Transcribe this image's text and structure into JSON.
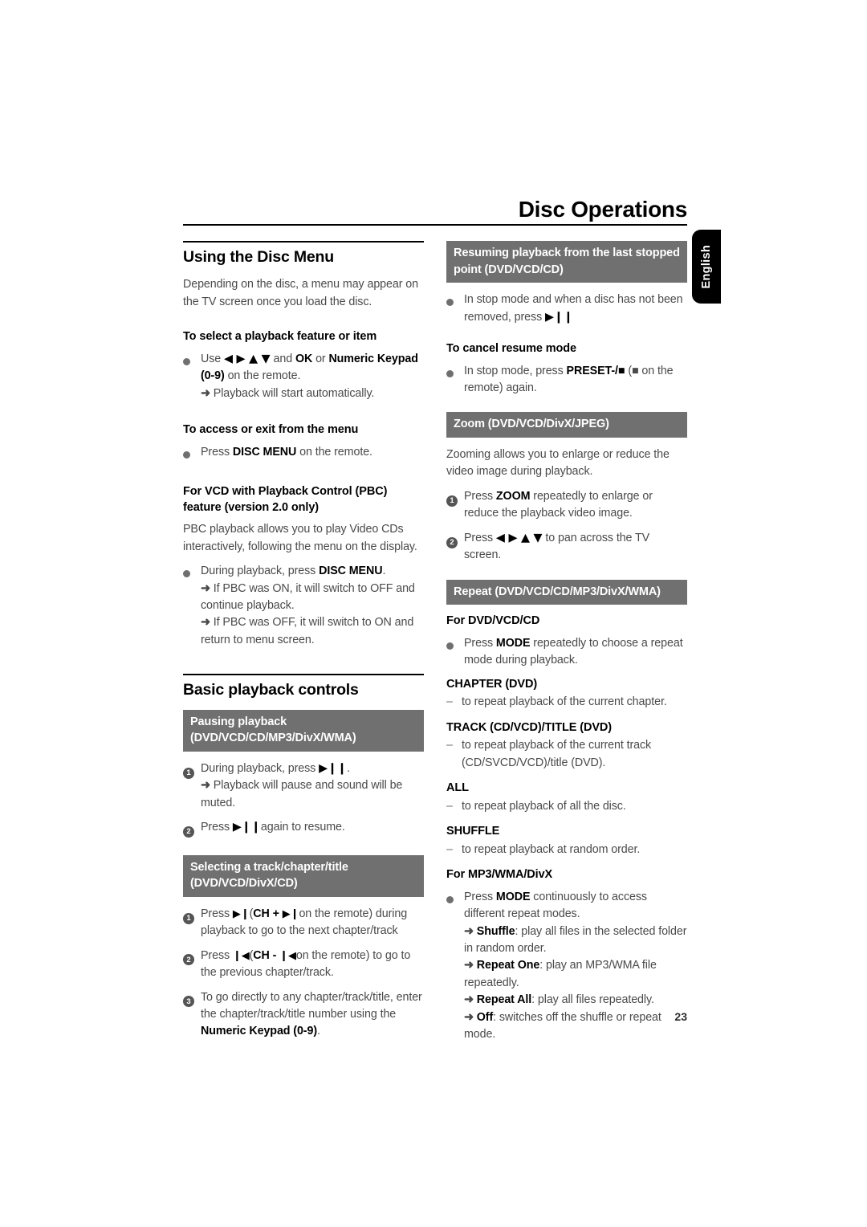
{
  "header": {
    "chapter_title": "Disc Operations",
    "language_tab": "English"
  },
  "page_number": "23",
  "left_column": {
    "section1": {
      "title": "Using the Disc Menu",
      "intro": "Depending on the disc, a menu may appear on the TV screen once you load the disc.",
      "sub1_title": "To select a playback feature or item",
      "sub1_bullet_pre": "Use",
      "sub1_glyphs": "◀ ▶ ▲ ▼",
      "sub1_bullet_mid": "and",
      "sub1_ok": "OK",
      "sub1_or": "or",
      "sub1_keypad": "Numeric Keypad (0-9)",
      "sub1_tail": "on the remote.",
      "sub1_result": "Playback will start automatically.",
      "sub2_title": "To access or exit from the menu",
      "sub2_pre": "Press",
      "sub2_key": "DISC MENU",
      "sub2_tail": "on the remote.",
      "sub3_title": "For VCD with Playback Control (PBC) feature (version 2.0 only)",
      "sub3_para": "PBC playback allows you to play Video CDs interactively, following the menu on the display.",
      "sub3_bullet_pre": "During playback, press",
      "sub3_bullet_key": "DISC MENU",
      "sub3_bullet_end": ".",
      "sub3_result1": "If PBC was ON, it will switch to OFF and continue playback.",
      "sub3_result2": "If PBC was OFF, it will switch to ON and return to menu screen."
    },
    "section2": {
      "title": "Basic playback controls",
      "band1": "Pausing playback (DVD/VCD/CD/MP3/DivX/WMA)",
      "step1_pre": "During playback, press",
      "step1_glyph": "▶❙❙",
      "step1_end": ".",
      "step1_result": "Playback will pause and sound will be muted.",
      "step2_pre": "Press",
      "step2_glyph": "▶❙❙",
      "step2_tail": "again to resume.",
      "band2": "Selecting a track/chapter/title (DVD/VCD/DivX/CD)",
      "s2_step1_pre": "Press",
      "s2_step1_glyph": "▶❙",
      "s2_step1_mid_open": "(",
      "s2_step1_key": "CH +",
      "s2_step1_key_glyph": "▶❙",
      "s2_step1_tail": "on the remote) during playback to go to the next chapter/track",
      "s2_step2_pre": "Press",
      "s2_step2_glyph": "❙◀",
      "s2_step2_key": "CH -",
      "s2_step2_key_glyph": "❙◀",
      "s2_step2_tail": "on the remote) to go to the previous chapter/track.",
      "s2_step3_pre": "To go directly to any chapter/track/title, enter the chapter/track/title number using the",
      "s2_step3_key": "Numeric Keypad (0-9)",
      "s2_step3_end": "."
    }
  },
  "right_column": {
    "band_resume": "Resuming playback from the last stopped point (DVD/VCD/CD)",
    "resume_bullet_pre": "In stop mode and when a disc has not been removed, press",
    "resume_bullet_glyph": "▶❙❙",
    "cancel_title": "To cancel resume mode",
    "cancel_pre": "In stop mode, press",
    "cancel_key": "PRESET-/■",
    "cancel_mid": "(■ on the remote) again.",
    "band_zoom": "Zoom (DVD/VCD/DivX/JPEG)",
    "zoom_para": "Zooming allows you to enlarge or reduce the video image during playback.",
    "zoom_step1_pre": "Press",
    "zoom_step1_key": "ZOOM",
    "zoom_step1_tail": "repeatedly to enlarge or reduce the playback video image.",
    "zoom_step2_pre": "Press",
    "zoom_step2_glyphs": "◀ ▶ ▲ ▼",
    "zoom_step2_tail": "to pan across the TV screen.",
    "band_repeat": "Repeat (DVD/VCD/CD/MP3/DivX/WMA)",
    "repeat_sub1": "For DVD/VCD/CD",
    "repeat_bullet_pre": "Press",
    "repeat_bullet_key": "MODE",
    "repeat_bullet_tail": "repeatedly to choose a repeat mode during playback.",
    "modes": [
      {
        "name": "CHAPTER (DVD)",
        "desc": "to repeat playback of the current chapter."
      },
      {
        "name": "TRACK (CD/VCD)/TITLE (DVD)",
        "desc": "to repeat playback of the current track (CD/SVCD/VCD)/title (DVD)."
      },
      {
        "name": "ALL",
        "desc": "to repeat playback of all the disc."
      },
      {
        "name": "SHUFFLE",
        "desc": "to repeat playback at random order."
      }
    ],
    "repeat_sub2": "For MP3/WMA/DivX",
    "mp3_bullet_pre": "Press",
    "mp3_bullet_key": "MODE",
    "mp3_bullet_tail": "continuously to access different repeat modes.",
    "mp3_results": [
      {
        "key": "Shuffle",
        "desc": ": play all files in the selected folder in random order."
      },
      {
        "key": "Repeat One",
        "desc": ": play an MP3/WMA file repeatedly."
      },
      {
        "key": "Repeat All",
        "desc": ": play all files repeatedly."
      },
      {
        "key": "Off",
        "desc": ": switches off the shuffle or repeat mode."
      }
    ]
  }
}
